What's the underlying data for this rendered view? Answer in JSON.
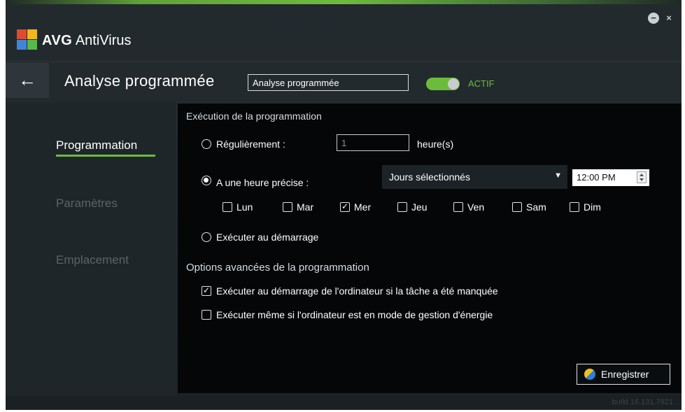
{
  "app": {
    "brand": "AVG",
    "product": "AntiVirus",
    "build": "build 16.131.7921",
    "colors": {
      "accent": "#6cbc3c",
      "background": "#232a2e",
      "panel": "#040608"
    }
  },
  "window_controls": {
    "minimize_icon": "minus-icon",
    "close_icon": "close-icon"
  },
  "header": {
    "back_icon": "arrow-left-icon",
    "title": "Analyse programmée",
    "name_value": "Analyse programmée",
    "toggle_label": "ACTIF"
  },
  "sidebar": {
    "items": [
      {
        "label": "Programmation"
      },
      {
        "label": "Paramètres"
      },
      {
        "label": "Emplacement"
      }
    ]
  },
  "schedule": {
    "section_title": "Exécution de la programmation",
    "regular_label": "Régulièrement :",
    "regular_value": "1",
    "regular_unit": "heure(s)",
    "precise_label": "A une heure précise :",
    "days_select": "Jours sélectionnés",
    "time_value": "12:00 PM",
    "days": [
      {
        "label": "Lun",
        "check": ""
      },
      {
        "label": "Mar",
        "check": ""
      },
      {
        "label": "Mer",
        "check": "✓"
      },
      {
        "label": "Jeu",
        "check": ""
      },
      {
        "label": "Ven",
        "check": ""
      },
      {
        "label": "Sam",
        "check": ""
      },
      {
        "label": "Dim",
        "check": ""
      }
    ],
    "startup_label": "Exécuter au démarrage"
  },
  "advanced": {
    "section_title": "Options avancées de la programmation",
    "missed_check": "✓",
    "missed_label": "Exécuter au démarrage de l'ordinateur si la tâche a été manquée",
    "power_check": "",
    "power_label": "Exécuter même si l'ordinateur est en mode de gestion d'énergie"
  },
  "footer": {
    "save_label": "Enregistrer"
  }
}
